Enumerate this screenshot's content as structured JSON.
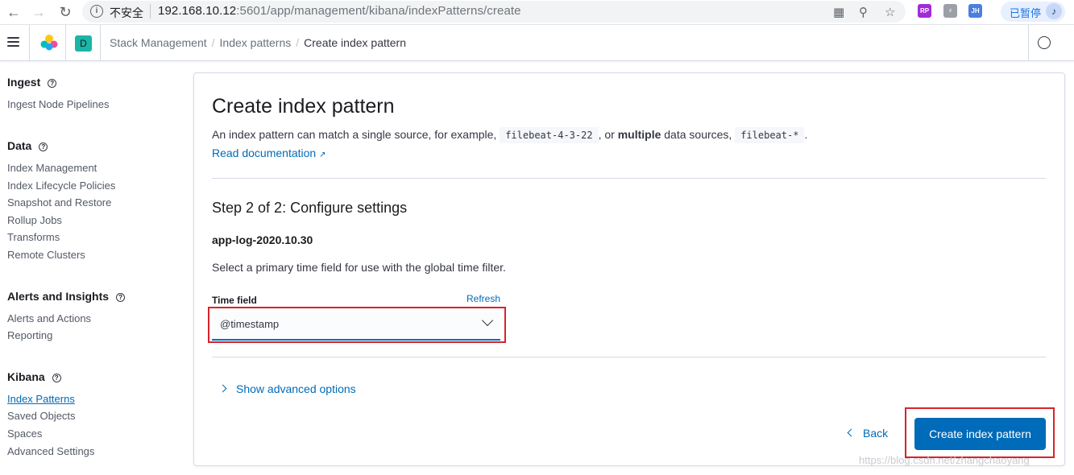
{
  "browser": {
    "insecure_label": "不安全",
    "url_host": "192.168.10.12",
    "url_path": ":5601/app/management/kibana/indexPatterns/create",
    "paused_label": "已暂停",
    "ext_rp": "RP",
    "ext_jh": "JH"
  },
  "header": {
    "space_badge": "D",
    "breadcrumbs": [
      "Stack Management",
      "Index patterns",
      "Create index pattern"
    ]
  },
  "sidebar": {
    "sections": [
      {
        "title": "Ingest",
        "items": [
          "Ingest Node Pipelines"
        ]
      },
      {
        "title": "Data",
        "items": [
          "Index Management",
          "Index Lifecycle Policies",
          "Snapshot and Restore",
          "Rollup Jobs",
          "Transforms",
          "Remote Clusters"
        ]
      },
      {
        "title": "Alerts and Insights",
        "items": [
          "Alerts and Actions",
          "Reporting"
        ]
      },
      {
        "title": "Kibana",
        "items": [
          "Index Patterns",
          "Saved Objects",
          "Spaces",
          "Advanced Settings"
        ]
      }
    ],
    "active_item": "Index Patterns"
  },
  "main": {
    "title": "Create index pattern",
    "desc_1": "An index pattern can match a single source, for example, ",
    "code_1": "filebeat-4-3-22",
    "desc_2": ", or ",
    "desc_bold": "multiple",
    "desc_3": " data sources, ",
    "code_2": "filebeat-*",
    "desc_4": ".",
    "doc_link": "Read documentation",
    "step_title": "Step 2 of 2: Configure settings",
    "index_pattern_name": "app-log-2020.10.30",
    "select_hint": "Select a primary time field for use with the global time filter.",
    "time_field_label": "Time field",
    "refresh_label": "Refresh",
    "time_field_value": "@timestamp",
    "advanced_label": "Show advanced options",
    "back_label": "Back",
    "create_label": "Create index pattern"
  },
  "watermark": "https://blog.csdn.net/zhangchaoyang",
  "colors": {
    "primary": "#006bb8",
    "highlight": "#d8232a",
    "space_badge": "#1bb5a5"
  }
}
